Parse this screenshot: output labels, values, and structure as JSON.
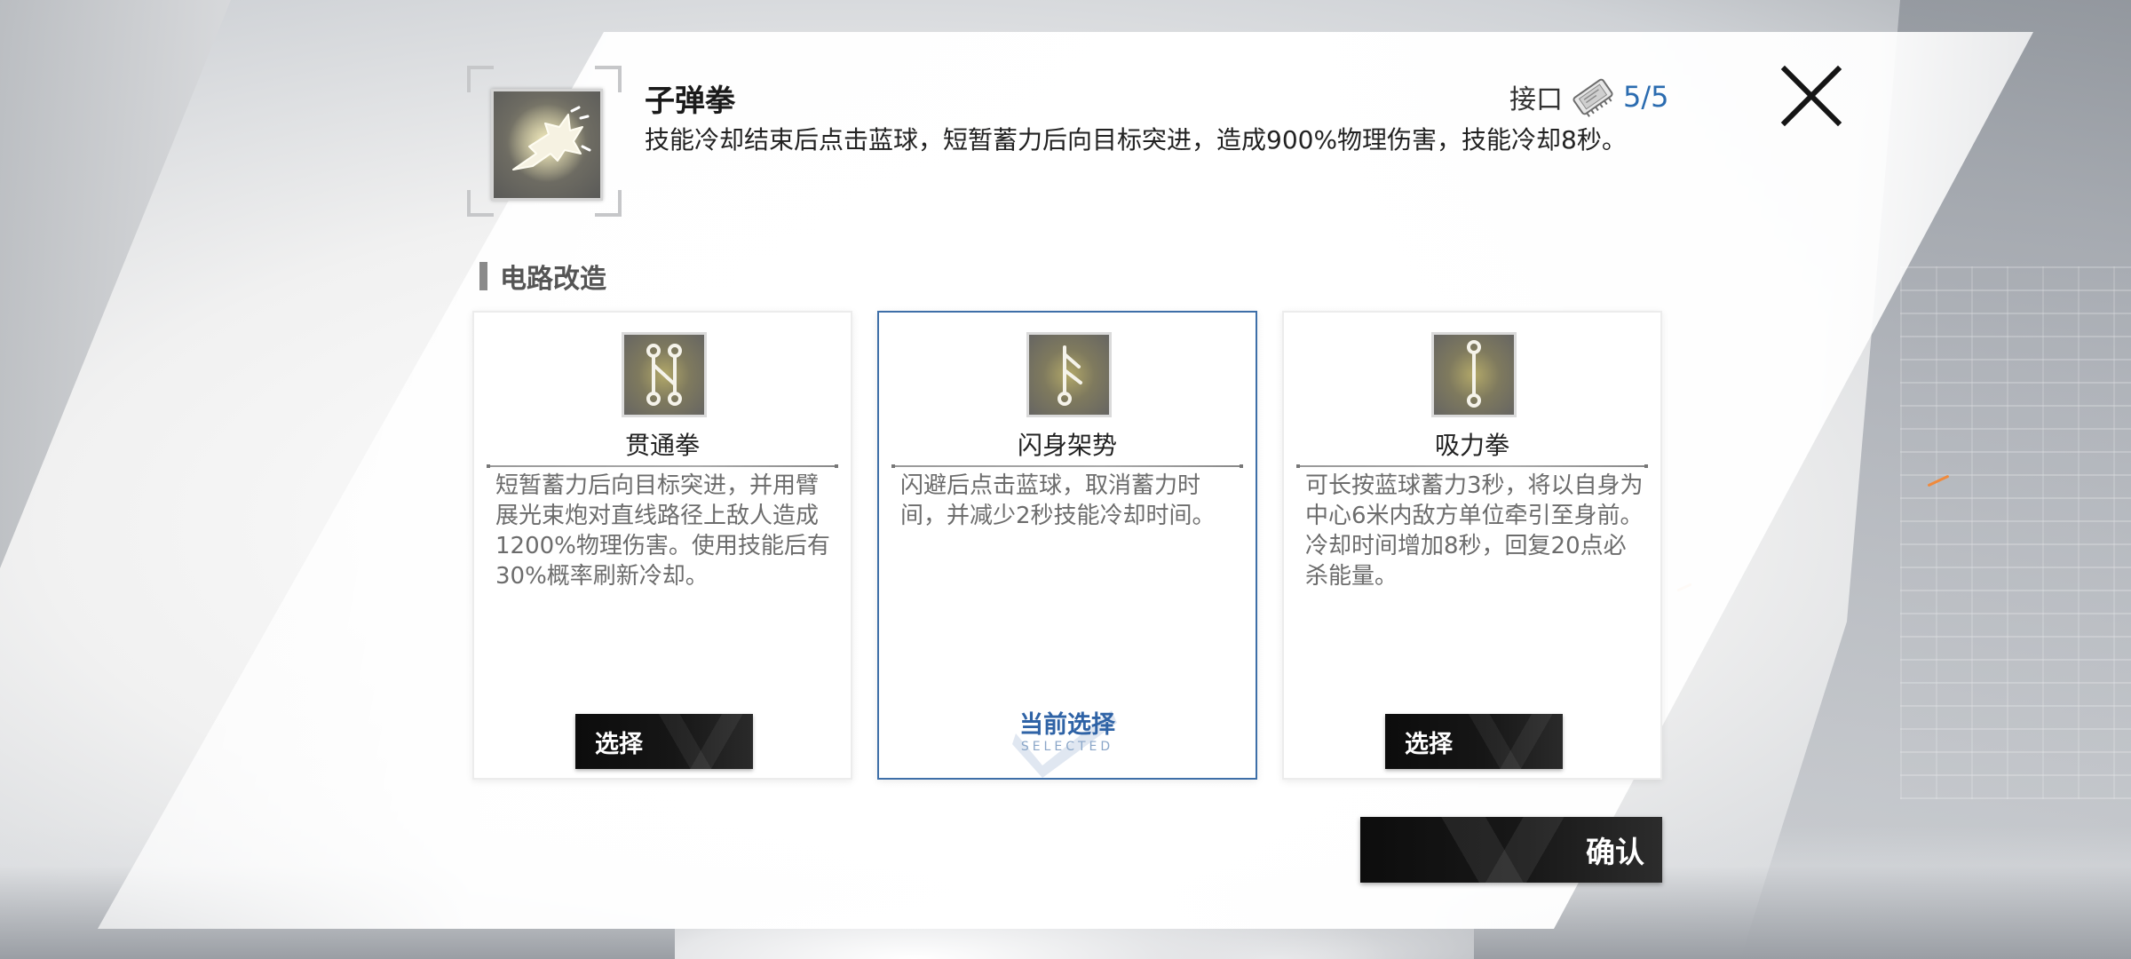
{
  "skill": {
    "name": "子弹拳",
    "description": "技能冷却结束后点击蓝球，短暂蓄力后向目标突进，造成900%物理伤害，技能冷却8秒。",
    "icon": "dash-punch-icon"
  },
  "slot": {
    "label": "接口",
    "icon": "chip-icon",
    "value": "5/5"
  },
  "close_icon": "close-icon",
  "section": {
    "title": "电路改造"
  },
  "cards": [
    {
      "name": "贯通拳",
      "icon": "circuit-zigzag-icon",
      "description": "短暂蓄力后向目标突进，并用臂展光束炮对直线路径上敌人造成1200%物理伤害。使用技能后有30%概率刷新冷却。",
      "selected": false,
      "button_label": "选择"
    },
    {
      "name": "闪身架势",
      "icon": "circuit-branch-icon",
      "description": "闪避后点击蓝球，取消蓄力时间，并减少2秒技能冷却时间。",
      "selected": true,
      "badge_label": "当前选择",
      "badge_sub": "SELECTED"
    },
    {
      "name": "吸力拳",
      "icon": "circuit-line-icon",
      "description": "可长按蓝球蓄力3秒，将以自身为中心6米内敌方单位牵引至身前。冷却时间增加8秒，回复20点必杀能量。",
      "selected": false,
      "button_label": "选择"
    }
  ],
  "confirm_label": "确认",
  "colors": {
    "accent_blue": "#2b6cb0",
    "selected_border": "#3e6fa8",
    "button_dark": "#111111"
  }
}
